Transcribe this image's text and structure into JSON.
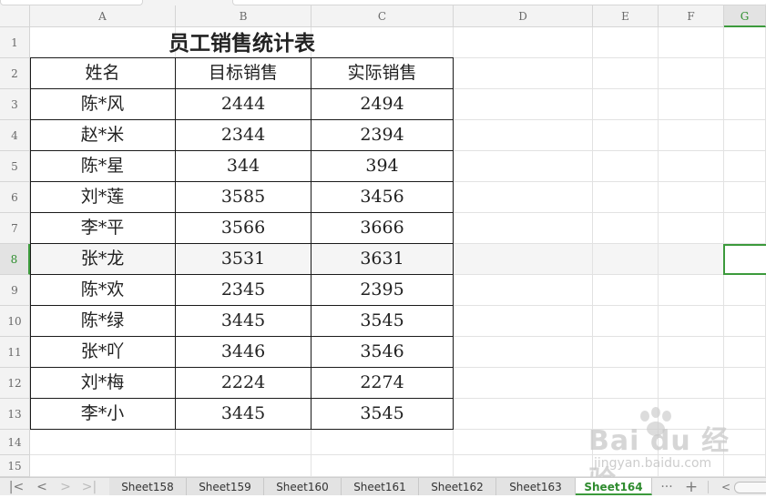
{
  "spreadsheet": {
    "columns": [
      "A",
      "B",
      "C",
      "D",
      "E",
      "F",
      "G"
    ],
    "rows": [
      "1",
      "2",
      "3",
      "4",
      "5",
      "6",
      "7",
      "8",
      "9",
      "10",
      "11",
      "12",
      "13",
      "14",
      "15"
    ],
    "selected_row": "8",
    "selected_col": "G",
    "title": "员工销售统计表",
    "headers": [
      "姓名",
      "目标销售",
      "实际销售"
    ],
    "data": [
      [
        "陈*风",
        "2444",
        "2494"
      ],
      [
        "赵*米",
        "2344",
        "2394"
      ],
      [
        "陈*星",
        "344",
        "394"
      ],
      [
        "刘*莲",
        "3585",
        "3456"
      ],
      [
        "李*平",
        "3566",
        "3666"
      ],
      [
        "张*龙",
        "3531",
        "3631"
      ],
      [
        "陈*欢",
        "2345",
        "2395"
      ],
      [
        "陈*绿",
        "3445",
        "3545"
      ],
      [
        "张*吖",
        "3446",
        "3546"
      ],
      [
        "刘*梅",
        "2224",
        "2274"
      ],
      [
        "李*小",
        "3445",
        "3545"
      ]
    ]
  },
  "sheet_tabs": [
    "Sheet158",
    "Sheet159",
    "Sheet160",
    "Sheet161",
    "Sheet162",
    "Sheet163",
    "Sheet164"
  ],
  "active_sheet": "Sheet164",
  "tabbar": {
    "first": "|<",
    "prev": "<",
    "next": ">",
    "last": ">|",
    "more": "···",
    "add": "+"
  },
  "watermark": {
    "brand": "Bai du 经验",
    "url": "jingyan.baidu.com"
  },
  "colors": {
    "accent": "#3c9a3c",
    "header_bg": "#f3f3f3",
    "grid_line": "#e2e2e2",
    "table_border": "#1a1a1a"
  }
}
